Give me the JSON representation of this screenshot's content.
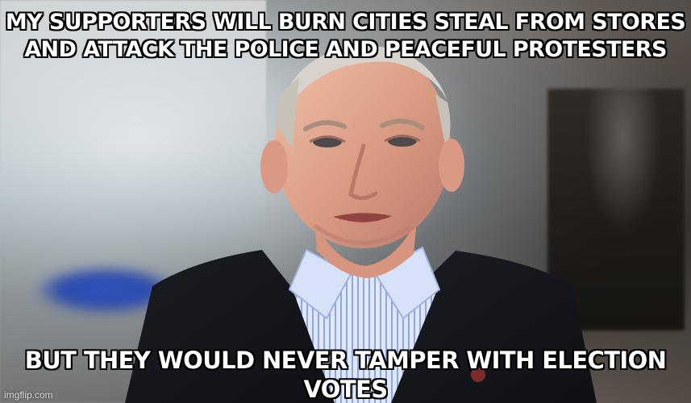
{
  "meme": {
    "top_text": "MY SUPPORTERS WILL BURN CITIES STEAL FROM STORES AND ATTACK THE POLICE AND PEACEFUL PROTESTERS",
    "bottom_text": "BUT THEY WOULD NEVER TAMPER WITH ELECTION VOTES",
    "watermark": "imgflip.com"
  }
}
